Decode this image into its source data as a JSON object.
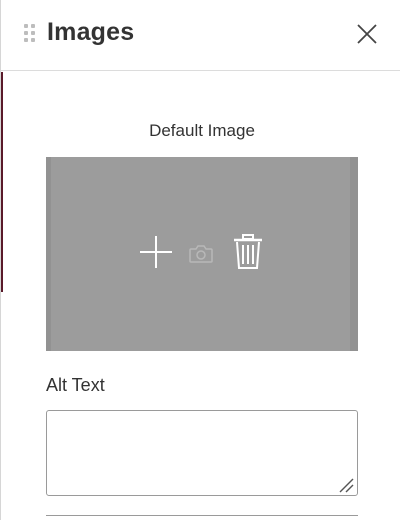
{
  "header": {
    "title": "Images",
    "drag_icon": "drag-handle-icon",
    "close_icon": "close-icon"
  },
  "default_image": {
    "label": "Default Image",
    "placeholder_color": "#9c9c9c",
    "actions": [
      {
        "icon": "plus-icon",
        "purpose": "add-image"
      },
      {
        "icon": "camera-icon",
        "purpose": "camera"
      },
      {
        "icon": "trash-icon",
        "purpose": "delete-image"
      }
    ]
  },
  "alt_text": {
    "label": "Alt Text",
    "value": "",
    "placeholder": ""
  }
}
